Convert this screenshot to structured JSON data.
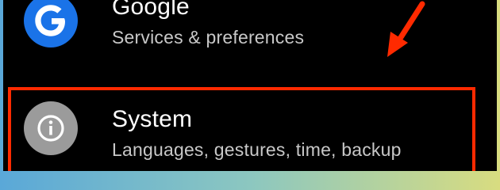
{
  "settings_list": {
    "items": [
      {
        "title": "Google",
        "subtitle": "Services & preferences",
        "icon": "google-g-icon",
        "icon_color": "#1a73e8"
      },
      {
        "title": "System",
        "subtitle": "Languages, gestures, time, backup",
        "icon": "info-icon",
        "icon_color": "#9b9b9b"
      }
    ]
  },
  "annotations": {
    "highlight_color": "#ff2a00",
    "highlighted_item": "System",
    "arrow_color": "#ff2a00"
  }
}
